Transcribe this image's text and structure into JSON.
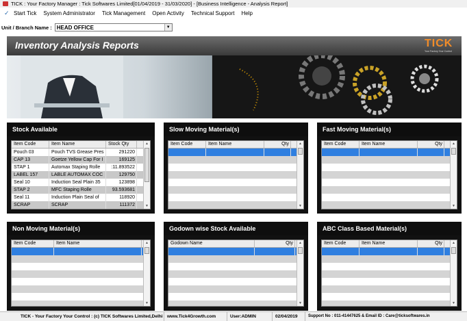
{
  "window": {
    "title": "TICK : Your Factory Manager : Tick Softwares Limited[01/04/2019 - 31/03/2020] - [Business Intelligence - Analysis Report]"
  },
  "menu": {
    "items": [
      "Start Tick",
      "System Administrator",
      "Tick Management",
      "Open Activity",
      "Technical Support",
      "Help"
    ]
  },
  "unit": {
    "label": "Unit / Branch Name :",
    "value": "HEAD OFFICE"
  },
  "banner": {
    "title": "Inventory Analysis Reports",
    "logo_text": "TICK",
    "logo_tagline": "Your Factory Your Control"
  },
  "panels": {
    "stock_available": {
      "title": "Stock Available",
      "columns": [
        "Item Code",
        "Item Name",
        "Stock Qty"
      ],
      "rows": [
        [
          "Pouch 03",
          "Pouch TVS Grease Pres",
          "291220"
        ],
        [
          "CAP 13",
          "Goetze Yellow Cap For I",
          "169125"
        ],
        [
          "STAP 1",
          "Automax Staping Rolle",
          ":11.893522"
        ],
        [
          "LABEL 157",
          "LABLE AUTOMAX COC",
          "129750"
        ],
        [
          "Seal 10",
          "Induction Seal Plain 35",
          "123898"
        ],
        [
          "STAP 2",
          "MFC Staping Rolle",
          "93.593681"
        ],
        [
          "Seal 11",
          "Induction Plain Seal of",
          "118920"
        ],
        [
          "SCRAP",
          "SCRAP",
          "111372"
        ]
      ]
    },
    "slow_moving": {
      "title": "Slow Moving Material(s)",
      "columns": [
        "Item Code",
        "Item Name",
        "Qty"
      ]
    },
    "fast_moving": {
      "title": "Fast Moving Material(s)",
      "columns": [
        "Item Code",
        "Item Name",
        "Qty"
      ]
    },
    "non_moving": {
      "title": "Non Moving Material(s)",
      "columns": [
        "Item Code",
        "Item Name"
      ]
    },
    "godown_stock": {
      "title": "Godown wise Stock Available",
      "columns": [
        "Godown Name",
        "Qty"
      ]
    },
    "abc_class": {
      "title": "ABC Class Based Material(s)",
      "columns": [
        "Item Code",
        "Item Name",
        "Qty"
      ]
    }
  },
  "status": {
    "left": "TICK - Your Factory Your Control : (c) TICK Softwares Limited,Delhi",
    "web": "www.Tick4Growth.com",
    "user": "User:ADMIN",
    "date": "02/04/2019",
    "support": "Support No : 011-41447625 & Email ID : Care@ticksoftwares.in"
  },
  "colors": {
    "selection": "#2f7fe0",
    "panel_bg": "#111111",
    "logo_orange": "#f28c28"
  }
}
